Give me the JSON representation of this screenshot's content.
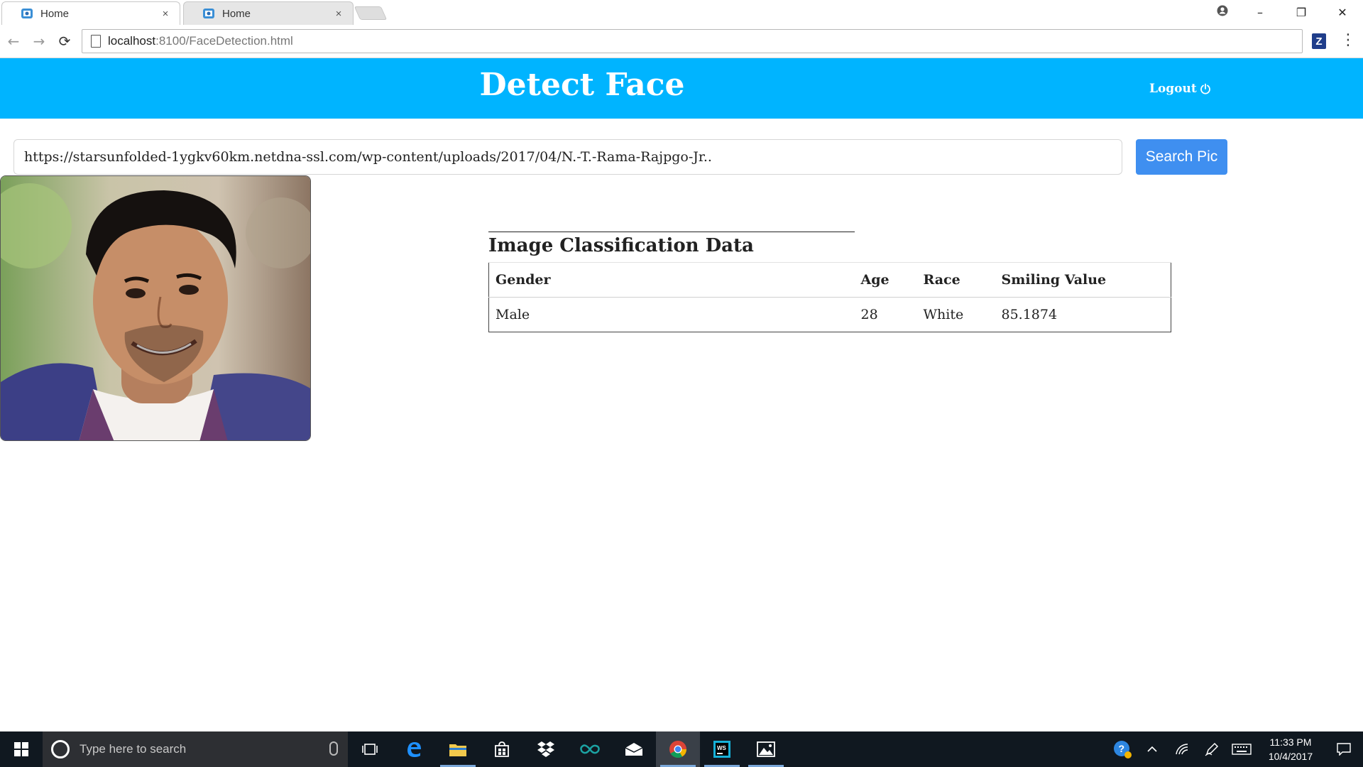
{
  "browser": {
    "tabs": [
      {
        "title": "Home",
        "close": "×"
      },
      {
        "title": "Home",
        "close": "×"
      }
    ],
    "window_controls": {
      "minimize": "–",
      "restore": "❐",
      "close": "✕"
    },
    "address": {
      "host": "localhost",
      "path": ":8100/FaceDetection.html"
    },
    "extension_label": "Z",
    "menu_glyph": "⋮",
    "nav": {
      "back": "←",
      "forward": "→",
      "reload": "⟳"
    }
  },
  "header": {
    "title": "Detect Face",
    "logout_label": "Logout"
  },
  "search": {
    "url_value": "https://starsunfolded-1ygkv60km.netdna-ssl.com/wp-content/uploads/2017/04/N.-T.-Rama-Rajpgo-Jr..",
    "button_label": "Search Pic"
  },
  "results": {
    "heading": "Image Classification Data",
    "columns": [
      "Gender",
      "Age",
      "Race",
      "Smiling Value"
    ],
    "rows": [
      [
        "Male",
        "28",
        "White",
        "85.1874"
      ]
    ]
  },
  "taskbar": {
    "search_placeholder": "Type here to search",
    "clock_time": "11:33 PM",
    "clock_date": "10/4/2017",
    "apps": [
      "task-view",
      "edge",
      "file-explorer",
      "store",
      "dropbox",
      "arduino",
      "mail",
      "chrome",
      "webstorm",
      "photos"
    ]
  },
  "colors": {
    "header_bg": "#00b4ff",
    "button_bg": "#3f8ff0",
    "taskbar_bg": "#101820"
  }
}
